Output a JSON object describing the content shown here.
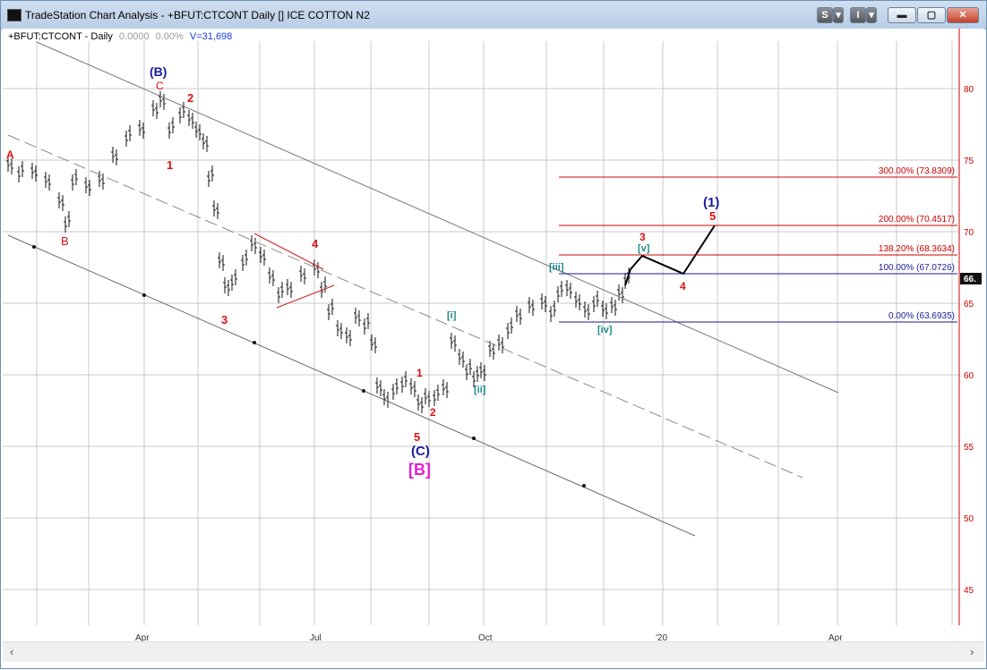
{
  "window": {
    "title": "TradeStation Chart Analysis - +BFUT:CTCONT Daily [] ICE COTTON N2",
    "buttons": {
      "s": "S",
      "s_arrow": "▾",
      "i": "I",
      "i_arrow": "▾",
      "minimize": "▬",
      "maximize": "▢",
      "close": "✕"
    }
  },
  "header": {
    "symbol": "+BFUT:CTCONT - Daily",
    "zero_a": "0.0000",
    "zero_b": "0.00%",
    "volume": "V=31,698"
  },
  "price_axis": {
    "ticks": [
      "80",
      "75",
      "70",
      "65",
      "60",
      "55",
      "50",
      "45"
    ],
    "last_price_tag": "66."
  },
  "time_axis": {
    "labels": [
      "Apr",
      "Jul",
      "Oct",
      "'20",
      "Apr"
    ]
  },
  "fib_levels": [
    {
      "label": "300.00% (73.8309)",
      "color": "#cc0000"
    },
    {
      "label": "200.00% (70.4517)",
      "color": "#cc0000"
    },
    {
      "label": "138.20% (68.3634)",
      "color": "#cc0000"
    },
    {
      "label": "100.00% (67.0726)",
      "color": "#1a1a9a"
    },
    {
      "label": "0.00% (63.6935)",
      "color": "#1a1a9a"
    }
  ],
  "wave_labels": {
    "A": "A",
    "B": "B",
    "C": "C",
    "B_paren": "(B)",
    "C_paren": "(C)",
    "B_bracket": "[B]",
    "one_paren": "(1)",
    "n1": "1",
    "n2": "2",
    "n3": "3",
    "n4": "4",
    "n5": "5",
    "i": "[i]",
    "ii": "[ii]",
    "iii": "[iii]",
    "iv": "[iv]",
    "v": "[v]"
  },
  "colors": {
    "red": "#dd1111",
    "navy": "#1a1aa0",
    "teal": "#1f8a8a",
    "magenta": "#e020d0",
    "price_axis_line": "#cc0000"
  },
  "icons": {
    "scroll_left": "‹",
    "scroll_right": "›"
  }
}
